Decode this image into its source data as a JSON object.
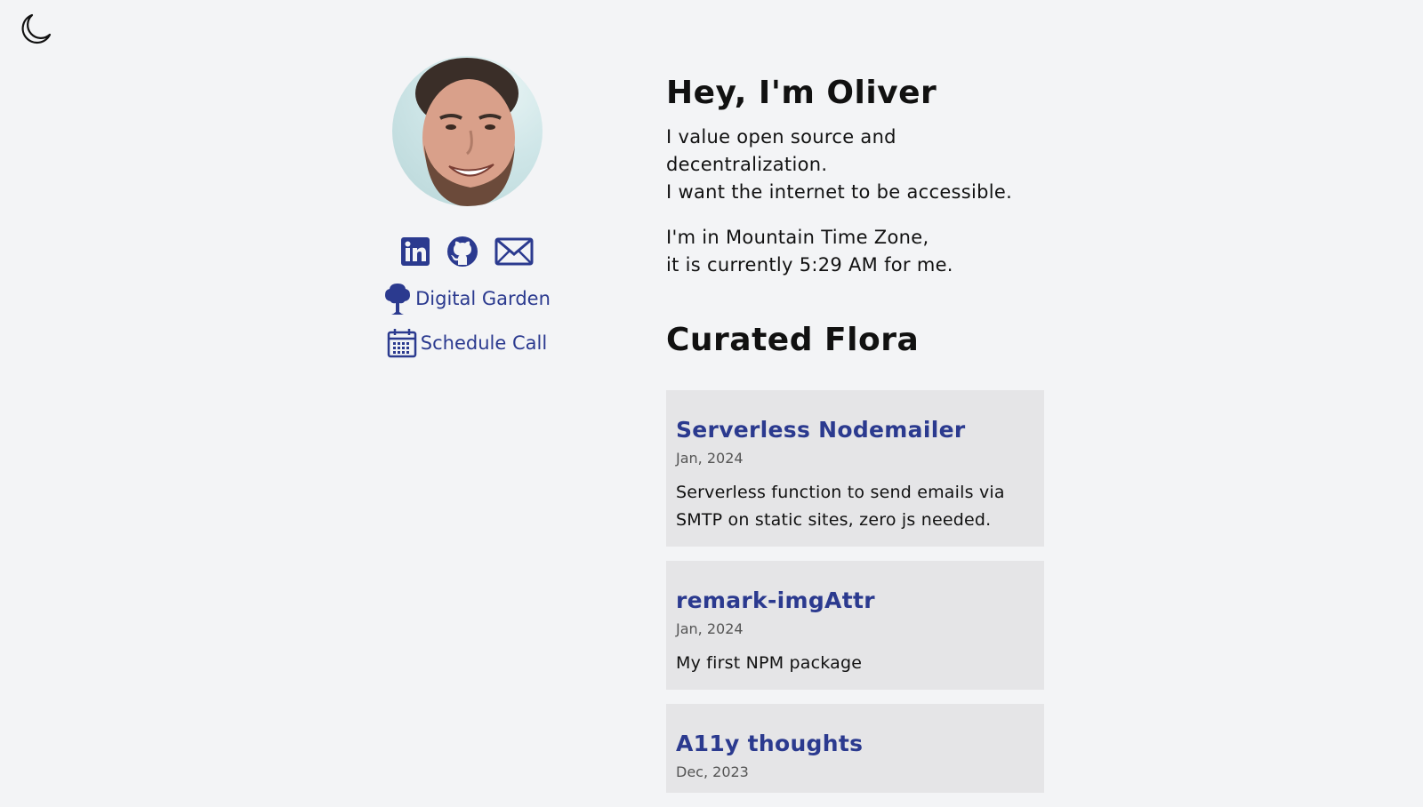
{
  "theme_toggle": {
    "icon": "moon-icon"
  },
  "profile": {
    "avatar_icon": "avatar",
    "socials": [
      {
        "icon": "linkedin-icon"
      },
      {
        "icon": "github-icon"
      },
      {
        "icon": "mail-icon"
      }
    ],
    "links": {
      "digital_garden": "Digital Garden",
      "schedule_call": "Schedule Call"
    }
  },
  "intro": {
    "heading": "Hey, I'm Oliver",
    "values_line1": "I value open source and decentralization.",
    "values_line2": "I want the internet to be accessible.",
    "timezone_line1": "I'm in Mountain Time Zone,",
    "timezone_line2": "it is currently 5:29 AM for me."
  },
  "curated": {
    "heading": "Curated Flora",
    "items": [
      {
        "title": "Serverless Nodemailer",
        "date": "Jan, 2024",
        "description": "Serverless function to send emails via SMTP on static sites, zero js needed."
      },
      {
        "title": "remark-imgAttr",
        "date": "Jan, 2024",
        "description": "My first NPM package"
      },
      {
        "title": "A11y thoughts",
        "date": "Dec, 2023",
        "description": ""
      }
    ]
  },
  "colors": {
    "background": "#f3f4f6",
    "accent": "#2b3a8f",
    "card": "#e5e5e7"
  }
}
